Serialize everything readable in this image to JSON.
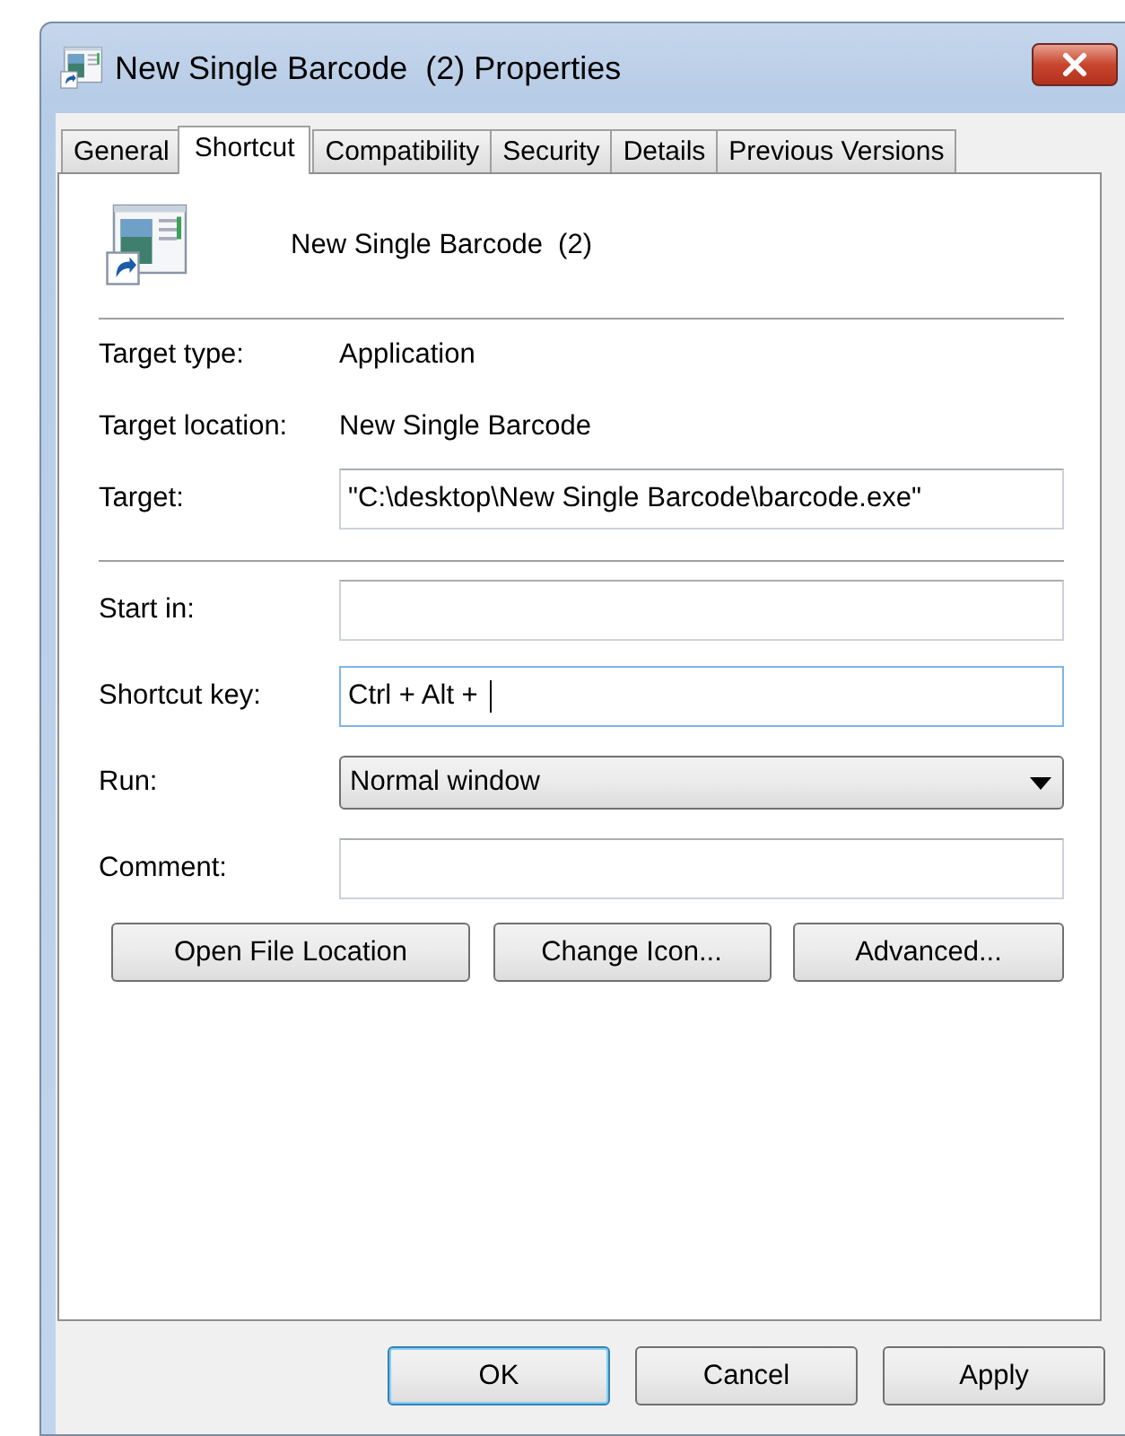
{
  "window": {
    "title": "New Single Barcode  (2) Properties"
  },
  "tabs": [
    {
      "label": "General",
      "selected": false
    },
    {
      "label": "Shortcut",
      "selected": true
    },
    {
      "label": "Compatibility",
      "selected": false
    },
    {
      "label": "Security",
      "selected": false
    },
    {
      "label": "Details",
      "selected": false
    },
    {
      "label": "Previous Versions",
      "selected": false
    }
  ],
  "shortcut_name": "New Single Barcode  (2)",
  "info": [
    {
      "label": "Target type:",
      "value": "Application"
    },
    {
      "label": "Target location:",
      "value": "New Single Barcode"
    }
  ],
  "target": {
    "label": "Target:",
    "value": "\"C:\\desktop\\New Single Barcode\\barcode.exe\""
  },
  "fields": [
    {
      "kind": "text",
      "label": "Start in:",
      "focused": false
    },
    {
      "kind": "text",
      "label": "Shortcut key:",
      "value": "Ctrl + Alt + ",
      "focused": true
    },
    {
      "kind": "dropdown",
      "label": "Run:",
      "value": "Normal window",
      "focused": false
    },
    {
      "kind": "text",
      "label": "Comment:",
      "focused": false
    }
  ],
  "actions": [
    {
      "label": "Open File Location"
    },
    {
      "label": "Change Icon..."
    },
    {
      "label": "Advanced..."
    }
  ],
  "buttons": [
    {
      "label": "OK",
      "default": true
    },
    {
      "label": "Cancel",
      "default": false
    },
    {
      "label": "Apply",
      "default": false
    }
  ]
}
